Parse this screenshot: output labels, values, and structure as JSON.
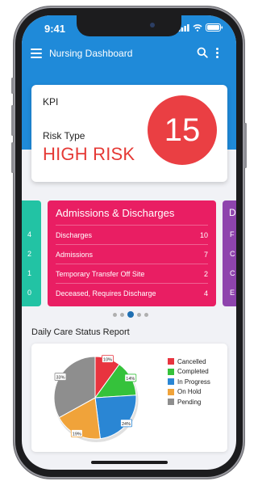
{
  "status_bar": {
    "time": "9:41"
  },
  "app_bar": {
    "title": "Nursing Dashboard"
  },
  "kpi": {
    "label": "KPI",
    "risk_type_label": "Risk Type",
    "risk_level": "HIGH RISK",
    "score": "15"
  },
  "peek_left": {
    "values": [
      "4",
      "2",
      "1",
      "0"
    ]
  },
  "peek_right": {
    "title_initial": "D",
    "row_initials": [
      "F",
      "C",
      "C",
      "E"
    ]
  },
  "admissions": {
    "title": "Admissions & Discharges",
    "rows": [
      {
        "label": "Discharges",
        "value": "10"
      },
      {
        "label": "Admissions",
        "value": "7"
      },
      {
        "label": "Temporary Transfer Off Site",
        "value": "2"
      },
      {
        "label": "Deceased, Requires Discharge",
        "value": "4"
      }
    ]
  },
  "carousel": {
    "count": 5,
    "active_index": 2
  },
  "care_report": {
    "title": "Daily Care Status Report"
  },
  "chart_data": {
    "type": "pie",
    "title": "",
    "series": [
      {
        "name": "Cancelled",
        "value": 10,
        "label": "10%",
        "color": "#e8343f"
      },
      {
        "name": "Completed",
        "value": 14,
        "label": "14%",
        "color": "#35c23b"
      },
      {
        "name": "In Progress",
        "value": 24,
        "label": "24%",
        "color": "#2a86d4"
      },
      {
        "name": "On Hold",
        "value": 19,
        "label": "19%",
        "color": "#f0a33a"
      },
      {
        "name": "Pending",
        "value": 33,
        "label": "33%",
        "color": "#8e8e8e"
      }
    ],
    "legend": "right"
  },
  "colors": {
    "primary": "#1f8ad9",
    "danger": "#e53935",
    "admissions": "#e91e63",
    "teal": "#22c3a4",
    "purple": "#8e44ad"
  }
}
